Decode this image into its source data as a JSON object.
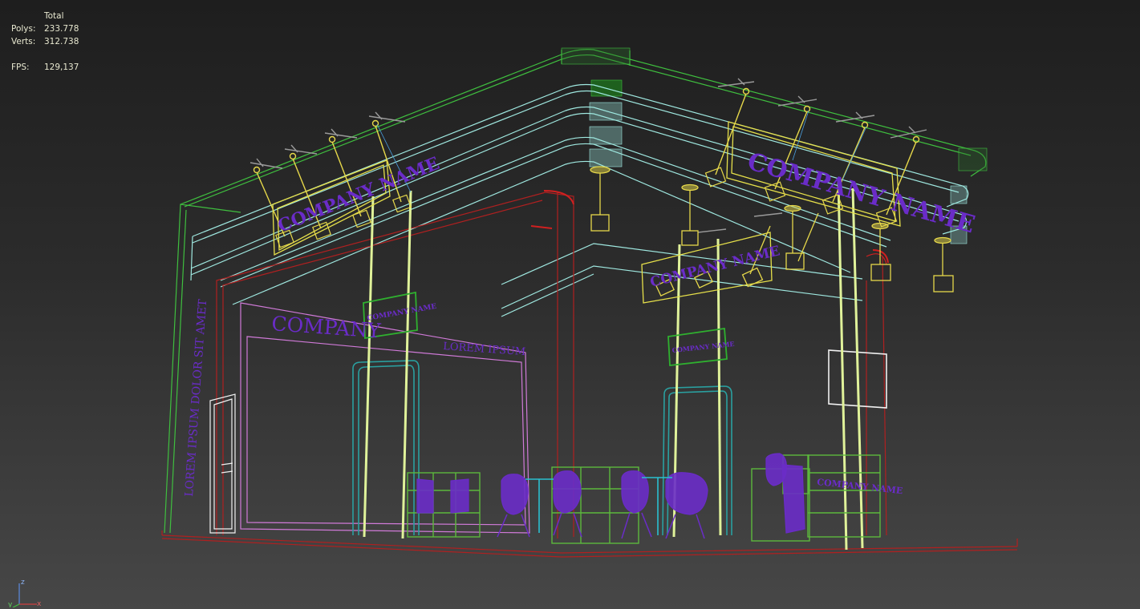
{
  "stats": {
    "header": "Total",
    "polys_label": "Polys:",
    "polys_value": "233.778",
    "verts_label": "Verts:",
    "verts_value": "312.738",
    "fps_label": "FPS:",
    "fps_value": "129,137"
  },
  "scene": {
    "sign_left": "COMPANY NAME",
    "sign_right": "COMPANY NAME",
    "sign_mid": "COMPANY NAME",
    "back_wall_text": "COMPANY",
    "back_wall_sub": "LOREM IPSUM",
    "side_wall_text": "LOREM IPSUM DOLOR SIT AMET",
    "small_sign_a": "COMPANY NAME",
    "small_sign_b": "COMPANY NAME",
    "counter_text": "COMPANY NAME"
  },
  "gizmo": {
    "z": "z",
    "y": "y",
    "x": "x"
  },
  "colors": {
    "green": "#3fbf3f",
    "cyan": "#9fe8e0",
    "yellow": "#e6d84a",
    "lime": "#e0f29a",
    "red": "#b02020",
    "purple": "#6a2cc8",
    "pink": "#d07ad8",
    "white": "#f0f0f0",
    "gray": "#9a9a9a"
  }
}
